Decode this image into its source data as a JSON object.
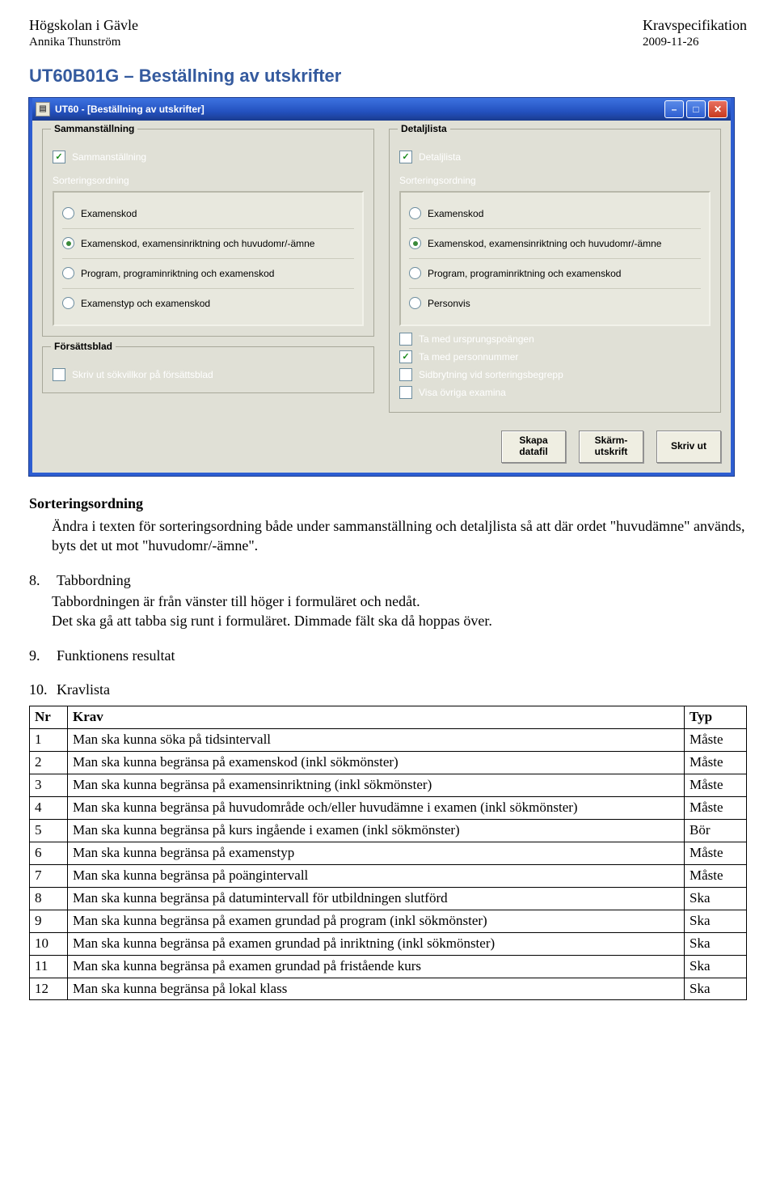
{
  "doc_header": {
    "org": "Högskolan i Gävle",
    "author": "Annika Thunström",
    "doc_type": "Kravspecifikation",
    "date": "2009-11-26"
  },
  "doc_title": "UT60B01G – Beställning av utskrifter",
  "window": {
    "title": "UT60 - [Beställning av utskrifter]",
    "left": {
      "group_title": "Sammanställning",
      "check_main": "Sammanställning",
      "sort_label": "Sorteringsordning",
      "radios": [
        {
          "label": "Examenskod",
          "selected": false
        },
        {
          "label": "Examenskod, examensinriktning och huvudomr/-ämne",
          "selected": true
        },
        {
          "label": "Program, programinriktning och examenskod",
          "selected": false
        },
        {
          "label": "Examenstyp och examenskod",
          "selected": false
        }
      ]
    },
    "right": {
      "group_title": "Detaljlista",
      "check_main": "Detaljlista",
      "sort_label": "Sorteringsordning",
      "radios": [
        {
          "label": "Examenskod",
          "selected": false
        },
        {
          "label": "Examenskod, examensinriktning och huvudomr/-ämne",
          "selected": true
        },
        {
          "label": "Program, programinriktning och examenskod",
          "selected": false
        },
        {
          "label": "Personvis",
          "selected": false
        }
      ],
      "extra": [
        {
          "label": "Ta med ursprungspoängen",
          "checked": false
        },
        {
          "label": "Ta med personnummer",
          "checked": true
        },
        {
          "label": "Sidbrytning vid sorteringsbegrepp",
          "checked": false
        },
        {
          "label": "Visa övriga examina",
          "checked": false
        }
      ]
    },
    "forsatt": {
      "group_title": "Försättsblad",
      "check": "Skriv ut sökvillkor på försättsblad"
    },
    "buttons": {
      "datafil": "Skapa\ndatafil",
      "skarm": "Skärm-\nutskrift",
      "skrivut": "Skriv ut"
    }
  },
  "sections": {
    "sort_title": "Sorteringsordning",
    "sort_body": "Ändra i texten för sorteringsordning både under sammanställning och detaljlista så att där ordet \"huvudämne\" används, byts det ut mot \"huvudomr/-ämne\".",
    "tab_num": "8.",
    "tab_title": "Tabbordning",
    "tab_body": "Tabbordningen är från vänster till höger i formuläret och nedåt.\nDet ska gå att tabba sig runt i formuläret. Dimmade fält ska då hoppas över.",
    "func_num": "9.",
    "func_title": "Funktionens resultat",
    "krav_num": "10.",
    "krav_title": "Kravlista"
  },
  "table": {
    "headers": {
      "nr": "Nr",
      "krav": "Krav",
      "typ": "Typ"
    },
    "rows": [
      {
        "nr": "1",
        "krav": "Man ska kunna söka på tidsintervall",
        "typ": "Måste"
      },
      {
        "nr": "2",
        "krav": "Man ska kunna begränsa på examenskod (inkl sökmönster)",
        "typ": "Måste"
      },
      {
        "nr": "3",
        "krav": "Man ska kunna begränsa på examensinriktning (inkl sökmönster)",
        "typ": "Måste"
      },
      {
        "nr": "4",
        "krav": "Man ska kunna begränsa på huvudområde och/eller huvudämne i examen (inkl sökmönster)",
        "typ": "Måste"
      },
      {
        "nr": "5",
        "krav": "Man ska kunna begränsa på kurs ingående i examen (inkl sökmönster)",
        "typ": "Bör"
      },
      {
        "nr": "6",
        "krav": "Man ska kunna begränsa på examenstyp",
        "typ": "Måste"
      },
      {
        "nr": "7",
        "krav": "Man ska kunna begränsa på poängintervall",
        "typ": "Måste"
      },
      {
        "nr": "8",
        "krav": "Man ska kunna begränsa på datumintervall för utbildningen slutförd",
        "typ": "Ska"
      },
      {
        "nr": "9",
        "krav": "Man ska kunna begränsa på examen grundad på program (inkl sökmönster)",
        "typ": "Ska"
      },
      {
        "nr": "10",
        "krav": "Man ska kunna begränsa på examen grundad på inriktning (inkl sökmönster)",
        "typ": "Ska"
      },
      {
        "nr": "11",
        "krav": "Man ska kunna begränsa på examen grundad på fristående kurs",
        "typ": "Ska"
      },
      {
        "nr": "12",
        "krav": "Man ska kunna begränsa på lokal klass",
        "typ": "Ska"
      }
    ]
  }
}
